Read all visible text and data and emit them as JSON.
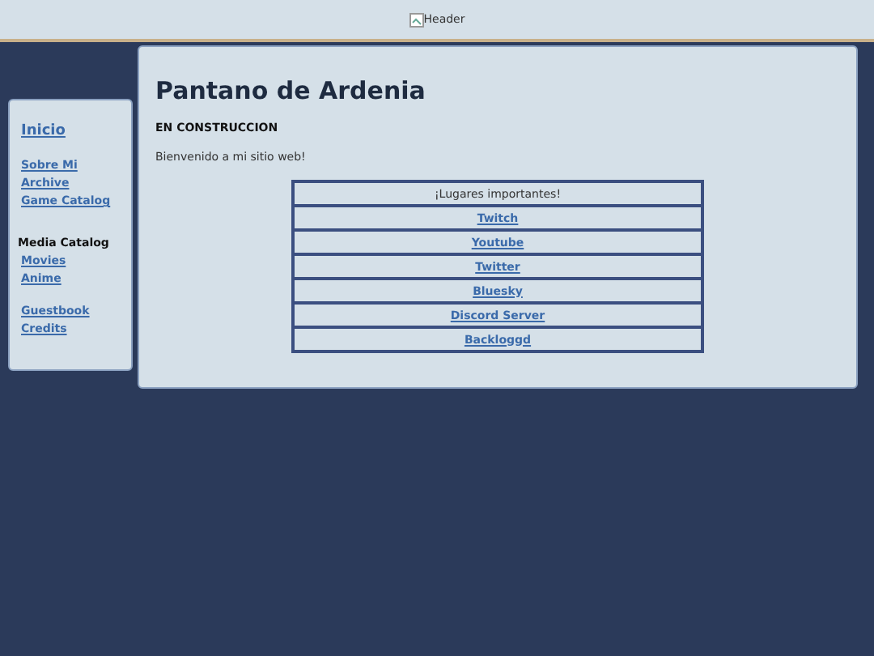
{
  "header": {
    "image_alt": "Header"
  },
  "sidebar": {
    "groups": [
      {
        "items": [
          {
            "kind": "title",
            "text": "Inicio"
          }
        ]
      },
      {
        "items": [
          {
            "kind": "link",
            "text": "Sobre Mi"
          },
          {
            "kind": "link",
            "text": "Archive"
          },
          {
            "kind": "link",
            "text": "Game Catalog"
          }
        ]
      },
      {
        "items": [
          {
            "kind": "heading",
            "text": "Media Catalog"
          },
          {
            "kind": "link",
            "text": "Movies"
          },
          {
            "kind": "link",
            "text": "Anime"
          }
        ]
      },
      {
        "items": [
          {
            "kind": "link",
            "text": "Guestbook"
          },
          {
            "kind": "link",
            "text": "Credits"
          }
        ]
      }
    ]
  },
  "main": {
    "title": "Pantano de Ardenia",
    "subtitle": "EN CONSTRUCCION",
    "welcome": "Bienvenido a mi sitio web!",
    "table": {
      "heading": "¡Lugares importantes!",
      "links": [
        "Twitch",
        "Youtube",
        "Twitter",
        "Bluesky",
        "Discord Server",
        "Backloggd"
      ]
    }
  }
}
